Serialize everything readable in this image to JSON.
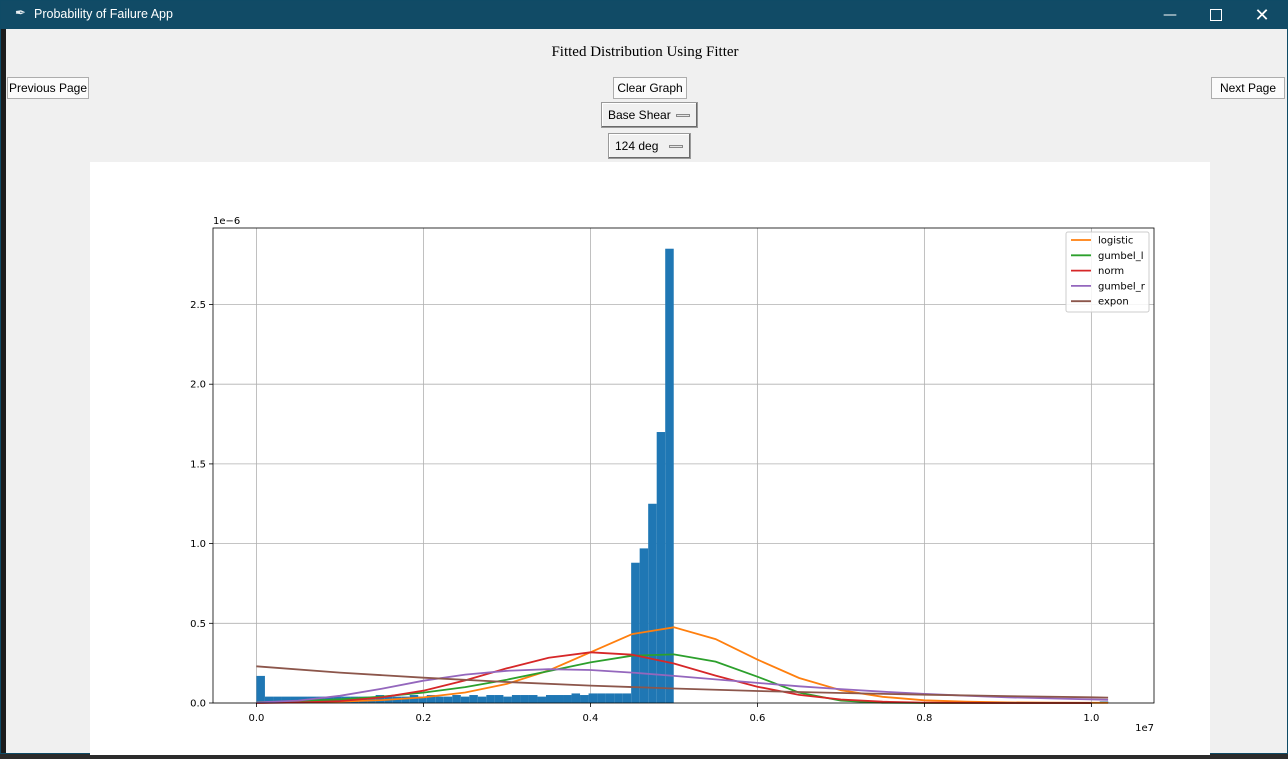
{
  "window": {
    "title": "Probability of Failure App",
    "icon": "feather-icon",
    "controls": [
      "minimize-icon",
      "maximize-icon",
      "close-icon"
    ]
  },
  "page": {
    "heading": "Fitted Distribution Using Fitter"
  },
  "buttons": {
    "previous": "Previous Page",
    "clear": "Clear Graph",
    "next": "Next Page"
  },
  "dropdowns": {
    "variable": "Base Shear",
    "angle": "124 deg"
  },
  "chart_data": {
    "type": "bar",
    "x_scale_label": "1e7",
    "y_scale_label": "1e−6",
    "xlim": [
      -0.052,
      1.075
    ],
    "ylim": [
      0,
      2.98
    ],
    "xticks": [
      0.0,
      0.2,
      0.4,
      0.6,
      0.8,
      1.0
    ],
    "yticks": [
      0.0,
      0.5,
      1.0,
      1.5,
      2.0,
      2.5
    ],
    "grid": true,
    "legend_position": "top-right",
    "histogram": {
      "color": "#1f77b4",
      "bin_width": 0.0102,
      "bins_start": [
        0.0,
        0.0102,
        0.0204,
        0.0306,
        0.0408,
        0.051,
        0.0612,
        0.0714,
        0.0816,
        0.0918,
        0.102,
        0.1122,
        0.1224,
        0.1326,
        0.1428,
        0.153,
        0.1632,
        0.1734,
        0.1836,
        0.1938,
        0.204,
        0.2142,
        0.2244,
        0.2346,
        0.2448,
        0.255,
        0.2652,
        0.2754,
        0.2856,
        0.2958,
        0.306,
        0.3162,
        0.3264,
        0.3366,
        0.3468,
        0.357,
        0.3672,
        0.3774,
        0.3876,
        0.3978,
        0.408,
        0.4182,
        0.4284,
        0.4386,
        0.4488,
        0.459,
        0.4692,
        0.4794,
        0.4896,
        1.01
      ],
      "heights": [
        0.17,
        0.04,
        0.04,
        0.04,
        0.04,
        0.04,
        0.04,
        0.04,
        0.04,
        0.04,
        0.04,
        0.04,
        0.04,
        0.04,
        0.05,
        0.04,
        0.04,
        0.04,
        0.05,
        0.04,
        0.05,
        0.04,
        0.04,
        0.05,
        0.04,
        0.05,
        0.04,
        0.05,
        0.05,
        0.04,
        0.05,
        0.05,
        0.05,
        0.04,
        0.05,
        0.05,
        0.05,
        0.06,
        0.05,
        0.06,
        0.06,
        0.06,
        0.06,
        0.06,
        0.88,
        0.97,
        1.25,
        1.7,
        2.85,
        0.01
      ]
    },
    "series": [
      {
        "name": "logistic",
        "color": "#ff7f0e",
        "x": [
          0.0,
          0.05,
          0.1,
          0.15,
          0.2,
          0.25,
          0.3,
          0.35,
          0.4,
          0.45,
          0.5,
          0.55,
          0.6,
          0.65,
          0.7,
          0.75,
          0.8,
          0.85,
          0.9,
          0.95,
          1.0,
          1.02
        ],
        "y": [
          0.002,
          0.004,
          0.009,
          0.018,
          0.035,
          0.066,
          0.12,
          0.204,
          0.318,
          0.432,
          0.475,
          0.401,
          0.272,
          0.157,
          0.08,
          0.039,
          0.017,
          0.008,
          0.004,
          0.002,
          0.001,
          0.001
        ]
      },
      {
        "name": "gumbel_l",
        "color": "#2ca02c",
        "x": [
          0.0,
          0.05,
          0.1,
          0.15,
          0.2,
          0.25,
          0.3,
          0.35,
          0.4,
          0.45,
          0.5,
          0.55,
          0.6,
          0.65,
          0.7,
          0.75,
          0.8,
          0.85,
          1.0
        ],
        "y": [
          0.005,
          0.012,
          0.023,
          0.04,
          0.065,
          0.1,
          0.146,
          0.2,
          0.255,
          0.297,
          0.305,
          0.26,
          0.165,
          0.065,
          0.015,
          0.002,
          0.0,
          0.0,
          0.0
        ]
      },
      {
        "name": "norm",
        "color": "#d62728",
        "x": [
          0.0,
          0.05,
          0.1,
          0.15,
          0.2,
          0.25,
          0.3,
          0.35,
          0.4,
          0.45,
          0.5,
          0.55,
          0.6,
          0.65,
          0.7,
          0.75,
          0.8,
          0.85,
          0.9,
          1.0
        ],
        "y": [
          0.0,
          0.003,
          0.012,
          0.035,
          0.077,
          0.142,
          0.218,
          0.284,
          0.318,
          0.303,
          0.248,
          0.172,
          0.102,
          0.051,
          0.022,
          0.008,
          0.002,
          0.001,
          0.0,
          0.0
        ]
      },
      {
        "name": "gumbel_r",
        "color": "#9467bd",
        "x": [
          0.0,
          0.05,
          0.1,
          0.15,
          0.2,
          0.25,
          0.3,
          0.35,
          0.4,
          0.45,
          0.5,
          0.55,
          0.6,
          0.65,
          0.7,
          0.75,
          0.8,
          0.85,
          0.9,
          0.95,
          1.02
        ],
        "y": [
          0.004,
          0.015,
          0.045,
          0.09,
          0.14,
          0.178,
          0.202,
          0.212,
          0.207,
          0.191,
          0.17,
          0.148,
          0.126,
          0.105,
          0.087,
          0.071,
          0.057,
          0.046,
          0.036,
          0.029,
          0.02
        ]
      },
      {
        "name": "expon",
        "color": "#8c564b",
        "x": [
          0.0,
          0.1,
          0.2,
          0.3,
          0.4,
          0.5,
          0.6,
          0.7,
          0.8,
          0.9,
          1.0,
          1.02
        ],
        "y": [
          0.23,
          0.191,
          0.159,
          0.132,
          0.109,
          0.091,
          0.075,
          0.063,
          0.052,
          0.043,
          0.036,
          0.034
        ]
      }
    ]
  }
}
